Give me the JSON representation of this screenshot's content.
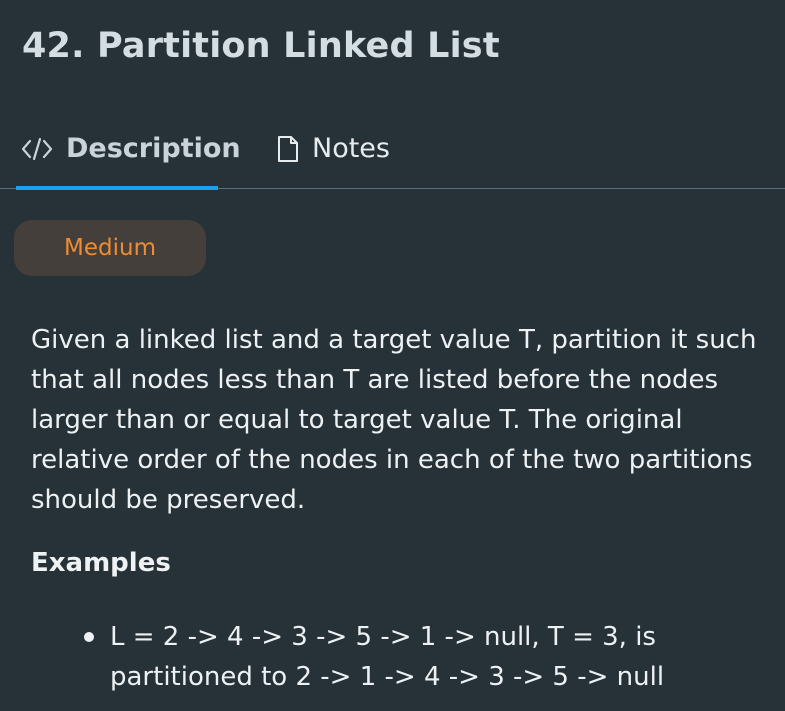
{
  "problem": {
    "title": "42. Partition Linked List",
    "difficulty": "Medium",
    "difficulty_color": "#ee8b33",
    "description": "Given a linked list and a target value T, partition it such that all nodes less than T are listed before the nodes larger than or equal to target value T. The original relative order of the nodes in each of the two partitions should be preserved.",
    "examples_heading": "Examples",
    "examples": [
      "L = 2 -> 4 -> 3 -> 5 -> 1 -> null, T = 3, is partitioned to 2 -> 1 -> 4 -> 3 -> 5 -> null"
    ]
  },
  "tabs": [
    {
      "label": "Description",
      "icon": "code-icon",
      "active": true
    },
    {
      "label": "Notes",
      "icon": "document-icon",
      "active": false
    }
  ],
  "theme": {
    "background": "#263238",
    "active_tab_underline": "#1ba1f2",
    "badge_background": "#443f3a"
  }
}
